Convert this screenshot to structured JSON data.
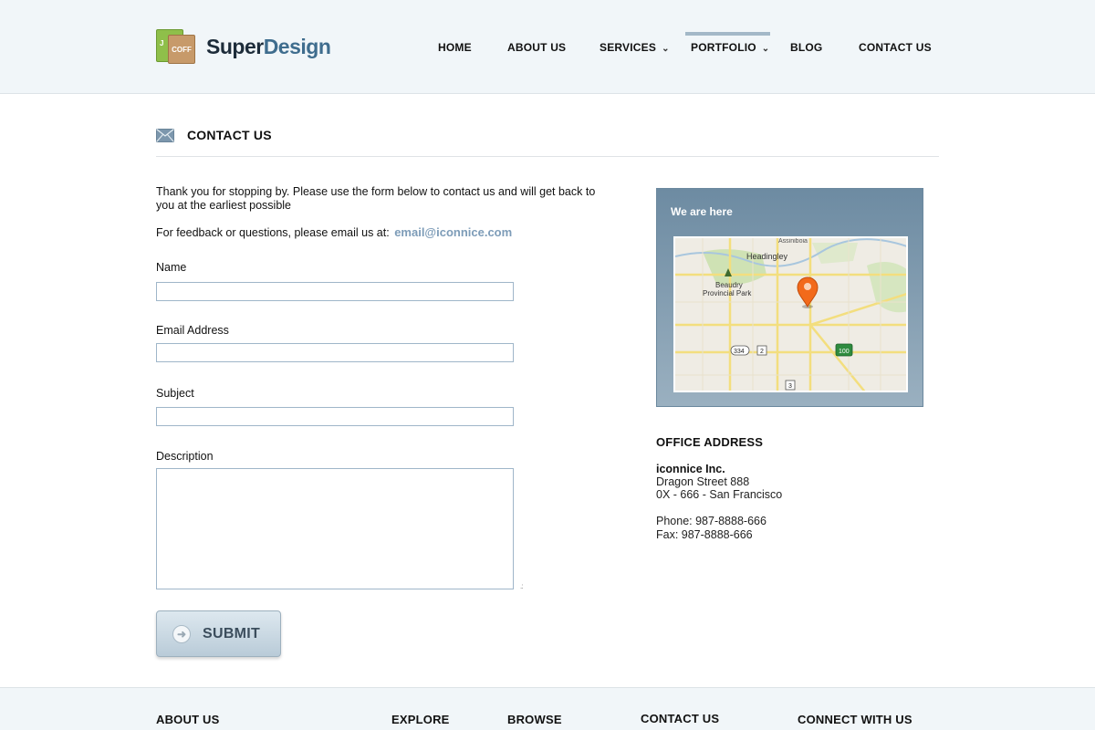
{
  "brand": {
    "name_part1": "Super",
    "name_part2": "Design",
    "mark_text_1": "J",
    "mark_text_2": "COFF"
  },
  "nav": {
    "items": [
      {
        "label": "HOME"
      },
      {
        "label": "ABOUT US"
      },
      {
        "label": "SERVICES"
      },
      {
        "label": "PORTFOLIO"
      },
      {
        "label": "BLOG"
      },
      {
        "label": "CONTACT US"
      }
    ],
    "active": "PORTFOLIO",
    "dropdown_caret": "⌄"
  },
  "page": {
    "title": "CONTACT US",
    "intro": "Thank you for stopping by. Please use the form below to contact us and will get back to you at the earliest possible",
    "feedback_prefix": "For feedback or questions, please email us at:",
    "feedback_email": "email@iconnice.com"
  },
  "form": {
    "name_label": "Name",
    "name_value": "",
    "email_label": "Email Address",
    "email_value": "",
    "subject_label": "Subject",
    "subject_value": "",
    "description_label": "Description",
    "description_value": "",
    "submit_label": "SUBMIT"
  },
  "map": {
    "title": "We are here",
    "labels": {
      "town": "Headingley",
      "park_line1": "Beaudry",
      "park_line2": "Provincial Park",
      "top_label": "Assiniboia",
      "route_334": "334",
      "route_2": "2",
      "route_100": "100",
      "route_3": "3"
    }
  },
  "office": {
    "title": "OFFICE ADDRESS",
    "company": "iconnice Inc.",
    "street": "Dragon Street 888",
    "city": "0X - 666 - San Francisco",
    "phone": "Phone: 987-8888-666",
    "fax": "Fax: 987-8888-666"
  },
  "footer": {
    "headings": [
      "ABOUT US",
      "EXPLORE",
      "BROWSE",
      "CONTACT US",
      "CONNECT WITH US"
    ]
  },
  "colors": {
    "header_bg": "#f1f6f9",
    "accent": "#7d9cb8",
    "active_nav_bar": "#a3b8c8",
    "map_box": "#6d8ba2",
    "pin": "#f26a1b"
  }
}
